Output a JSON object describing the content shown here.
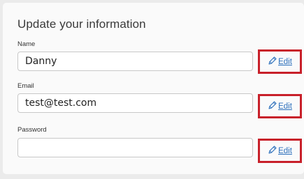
{
  "title": "Update your information",
  "fields": [
    {
      "label": "Name",
      "value": "Danny",
      "edit_label": "Edit"
    },
    {
      "label": "Email",
      "value": "test@test.com",
      "edit_label": "Edit"
    },
    {
      "label": "Password",
      "value": "",
      "edit_label": "Edit"
    }
  ],
  "icons": {
    "edit": "pencil-icon"
  },
  "colors": {
    "link": "#2a6ebb",
    "highlight_border": "#c8202a",
    "card_bg": "#fafafa",
    "page_bg": "#ebebeb"
  }
}
